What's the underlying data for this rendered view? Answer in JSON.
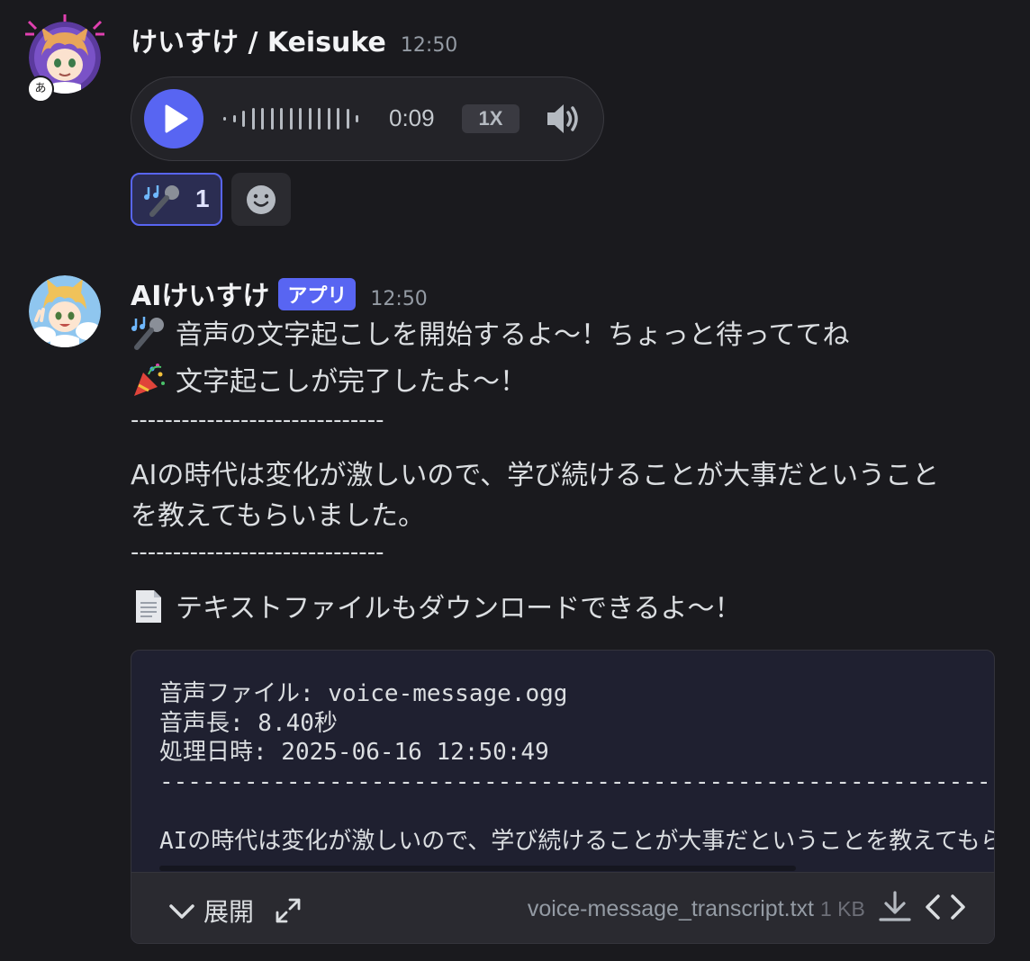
{
  "messages": [
    {
      "username": "けいすけ / Keisuke",
      "timestamp": "12:50",
      "voice": {
        "duration": "0:09",
        "speed": "1X",
        "play_icon": "play-icon",
        "volume_icon": "volume-icon"
      },
      "reactions": [
        {
          "emoji": "musical-microphone",
          "count": "1",
          "active": true
        }
      ],
      "add_reaction_icon": "smiley-icon"
    },
    {
      "username": "AIけいすけ",
      "badge": "アプリ",
      "timestamp": "12:50",
      "lines": {
        "l1": "音声の文字起こしを開始するよ〜！ちょっと待っててね",
        "l2": "文字起こしが完了したよ〜！",
        "dash1": "------------------------------",
        "t1": "AIの時代は変化が激しいので、学び続けることが大事だということ",
        "t2": "を教えてもらいました。",
        "dash2": "------------------------------",
        "l3": "テキストファイルもダウンロードできるよ〜！"
      },
      "attachment": {
        "code_lines": [
          "音声ファイル: voice-message.ogg",
          "音声長: 8.40秒",
          "処理日時: 2025-06-16 12:50:49",
          "------------------------------------------------------------"
        ],
        "code_last": "AIの時代は変化が激しいので、学び続けることが大事だということを教えてもらいました。",
        "expand_label": "展開",
        "filename": "voice-message_transcript.txt",
        "filesize": "1 KB"
      }
    }
  ],
  "colors": {
    "background": "#1a1a1e",
    "accent": "#5865f2",
    "text": "#dbdee1",
    "muted": "#949ba4"
  }
}
